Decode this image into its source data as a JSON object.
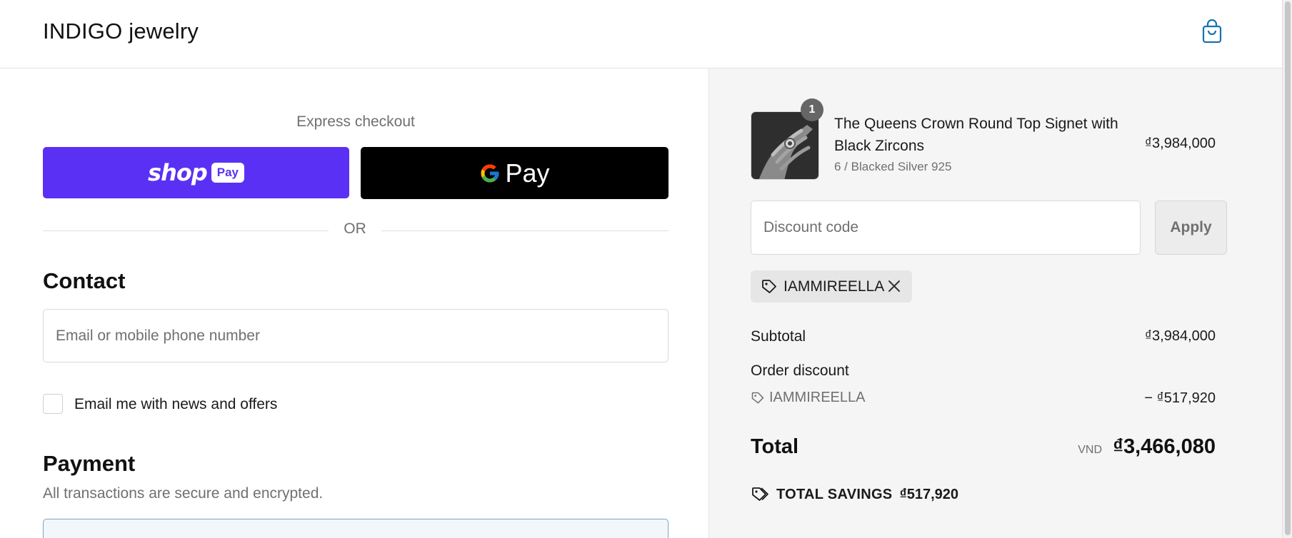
{
  "header": {
    "store_name": "INDIGO jewelry",
    "cart_icon": "shopping-bag-icon"
  },
  "express": {
    "label": "Express checkout",
    "shop_pay": {
      "word": "shop",
      "pill": "Pay",
      "color": "#5a31f4"
    },
    "google_pay": {
      "label": "Pay"
    },
    "or_text": "OR"
  },
  "contact": {
    "title": "Contact",
    "email_placeholder": "Email or mobile phone number",
    "newsletter_label": "Email me with news and offers",
    "newsletter_checked": false
  },
  "payment": {
    "title": "Payment",
    "subtitle": "All transactions are secure and encrypted."
  },
  "order": {
    "item": {
      "quantity": "1",
      "name": "The Queens Crown Round Top Signet with Black Zircons",
      "variant": "6 / Blacked Silver 925",
      "price": "₫3,984,000"
    },
    "discount_placeholder": "Discount code",
    "apply_label": "Apply",
    "applied_code": "IAMMIREELLA",
    "subtotal_label": "Subtotal",
    "subtotal_value": "₫3,984,000",
    "order_discount_label": "Order discount",
    "discount_code": "IAMMIREELLA",
    "discount_amount": "− ₫517,920",
    "total_label": "Total",
    "currency": "VND",
    "total_value": "₫3,466,080",
    "savings_label": "TOTAL SAVINGS",
    "savings_value": "₫517,920"
  }
}
